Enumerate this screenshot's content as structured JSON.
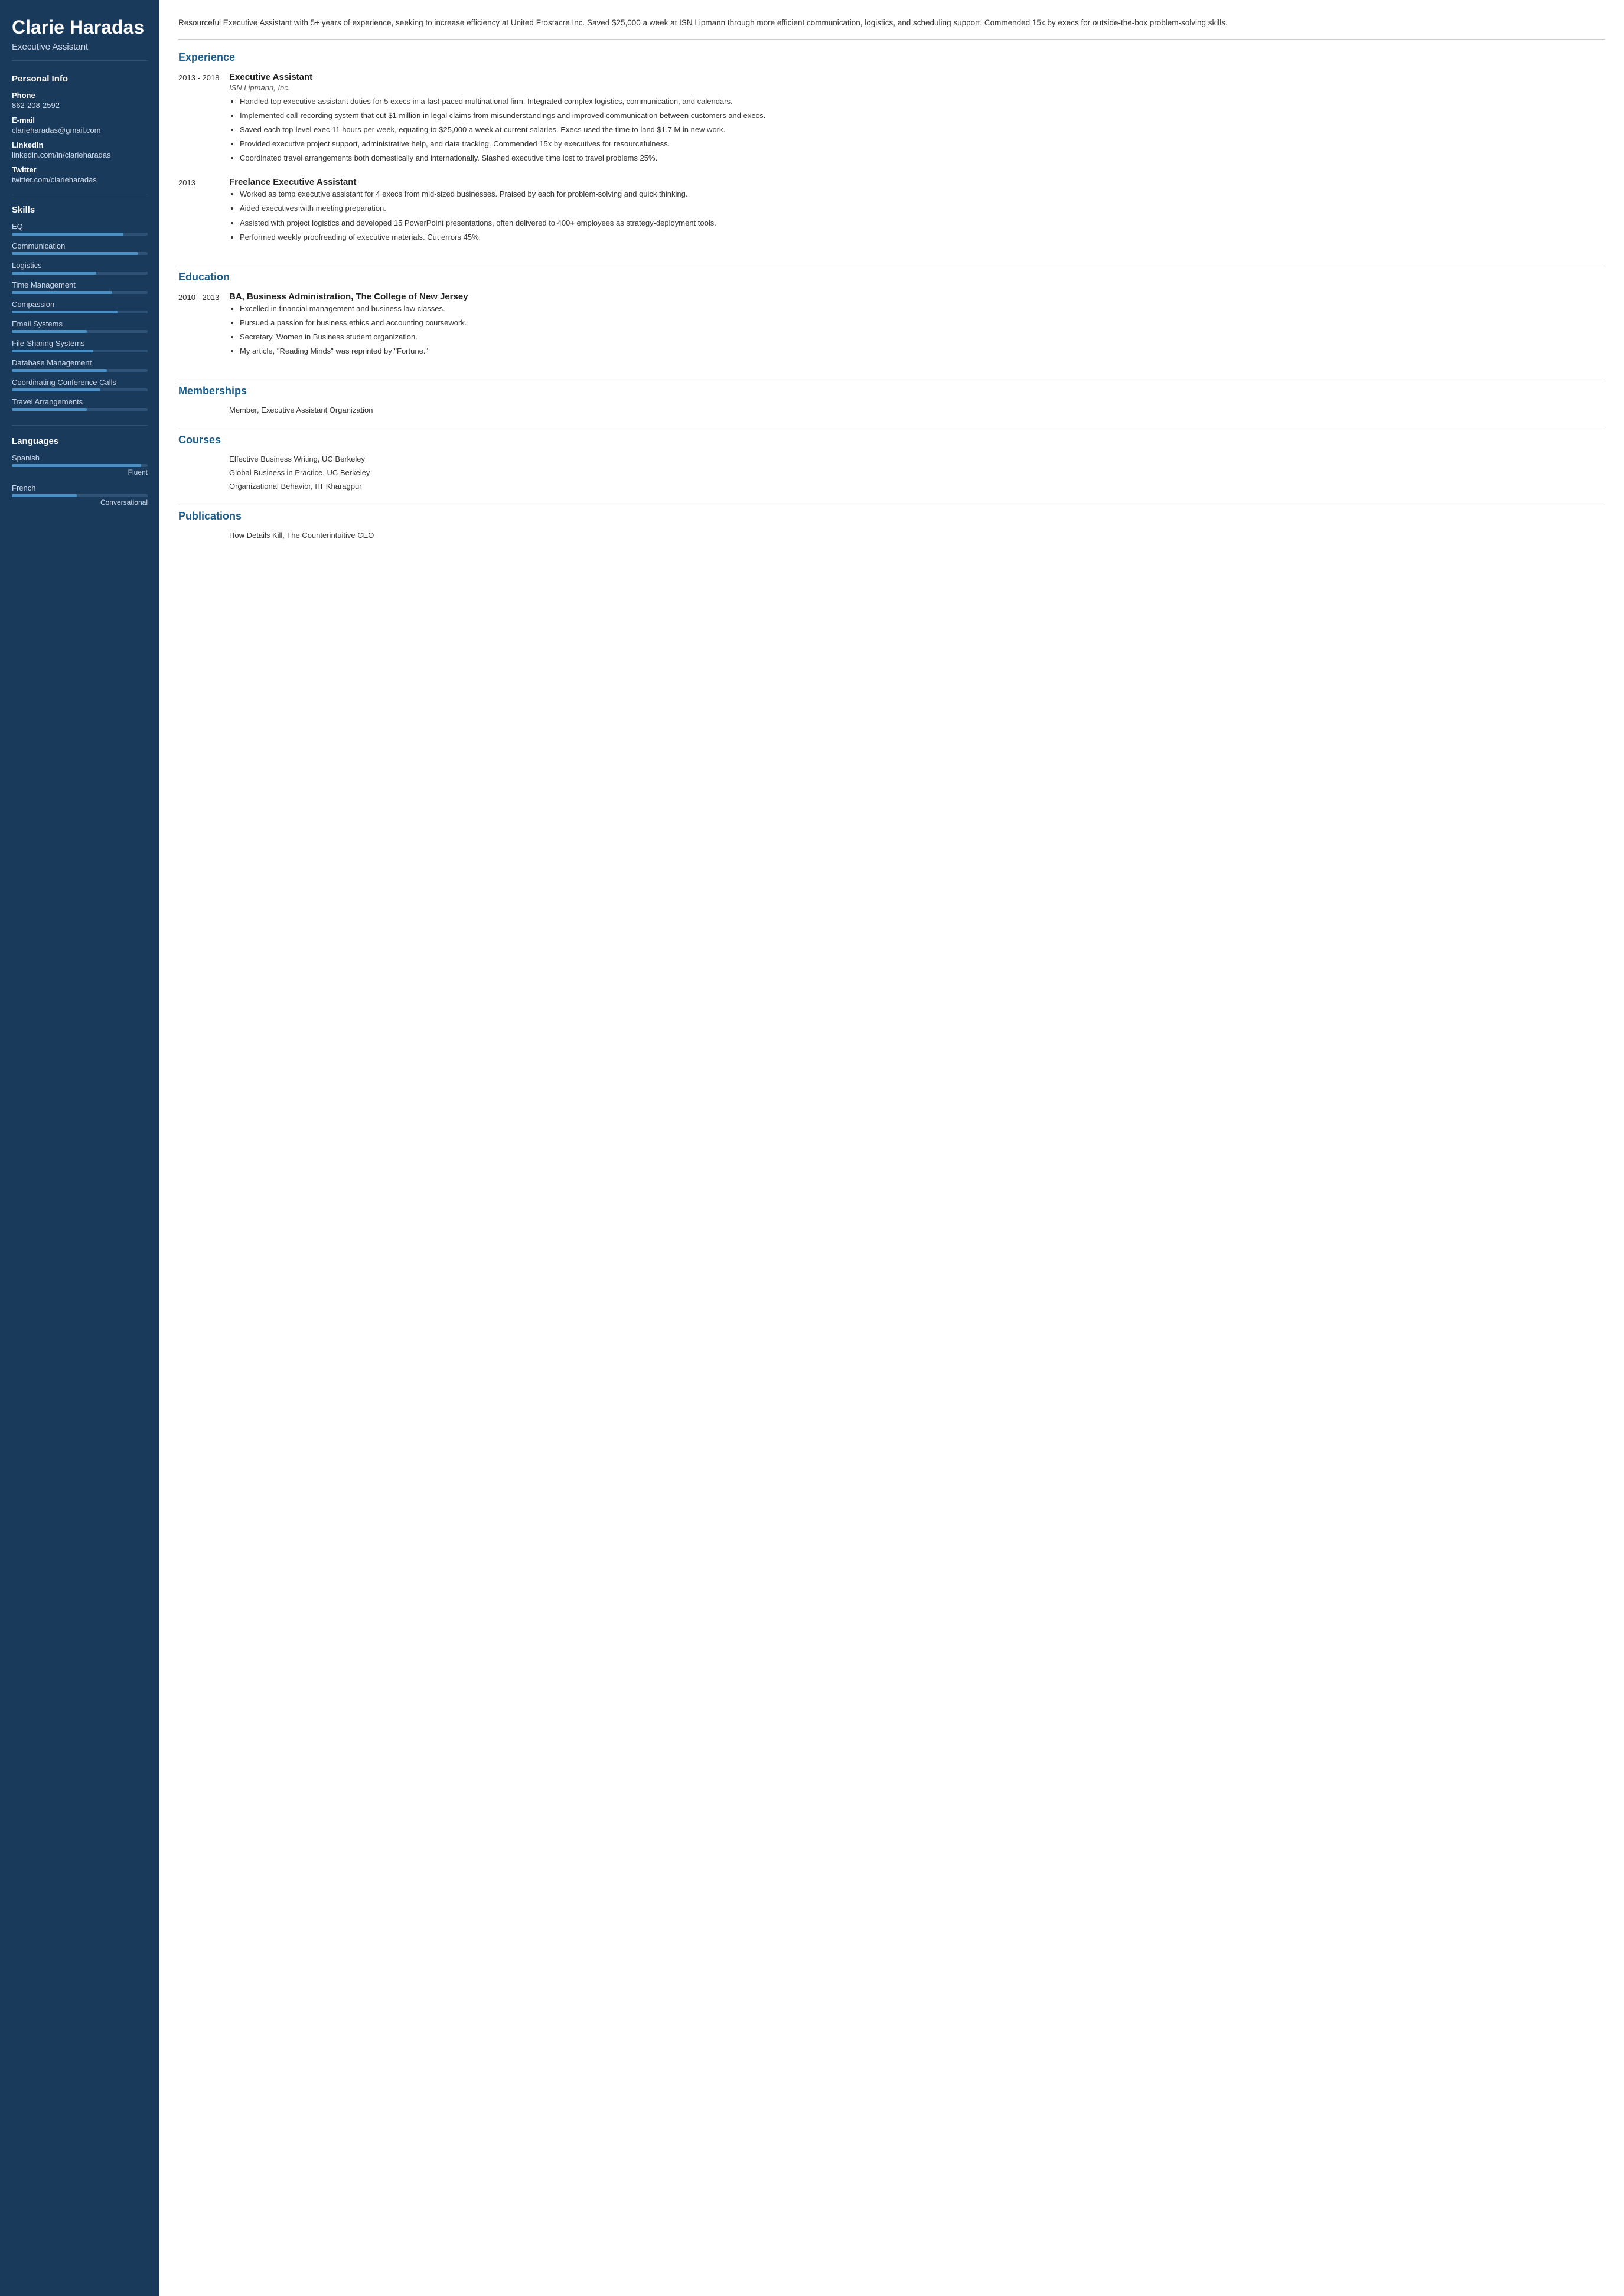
{
  "sidebar": {
    "name": "Clarie Haradas",
    "title": "Executive Assistant",
    "personal_info_title": "Personal Info",
    "phone_label": "Phone",
    "phone": "862-208-2592",
    "email_label": "E-mail",
    "email": "clarieharadas@gmail.com",
    "linkedin_label": "LinkedIn",
    "linkedin": "linkedin.com/in/clarieharadas",
    "twitter_label": "Twitter",
    "twitter": "twitter.com/clarieharadas",
    "skills_title": "Skills",
    "skills": [
      {
        "name": "EQ",
        "pct": 82
      },
      {
        "name": "Communication",
        "pct": 93
      },
      {
        "name": "Logistics",
        "pct": 62
      },
      {
        "name": "Time Management",
        "pct": 74
      },
      {
        "name": "Compassion",
        "pct": 78
      },
      {
        "name": "Email Systems",
        "pct": 55
      },
      {
        "name": "File-Sharing Systems",
        "pct": 60
      },
      {
        "name": "Database Management",
        "pct": 70
      },
      {
        "name": "Coordinating Conference Calls",
        "pct": 65
      },
      {
        "name": "Travel Arrangements",
        "pct": 55
      }
    ],
    "languages_title": "Languages",
    "languages": [
      {
        "name": "Spanish",
        "pct": 95,
        "level": "Fluent"
      },
      {
        "name": "French",
        "pct": 48,
        "level": "Conversational"
      }
    ]
  },
  "main": {
    "summary": "Resourceful Executive Assistant with 5+ years of experience, seeking to increase efficiency at United Frostacre Inc. Saved $25,000 a week at ISN Lipmann through more efficient communication, logistics, and scheduling support. Commended 15x by execs for outside-the-box problem-solving skills.",
    "experience_title": "Experience",
    "jobs": [
      {
        "date": "2013 - 2018",
        "title": "Executive Assistant",
        "company": "ISN Lipmann, Inc.",
        "bullets": [
          "Handled top executive assistant duties for 5 execs in a fast-paced multinational firm. Integrated complex logistics, communication, and calendars.",
          "Implemented call-recording system that cut $1 million in legal claims from misunderstandings and improved communication between customers and execs.",
          "Saved each top-level exec 11 hours per week, equating to $25,000 a week at current salaries. Execs used the time to land $1.7 M in new work.",
          "Provided executive project support, administrative help, and data tracking. Commended 15x by executives for resourcefulness.",
          "Coordinated travel arrangements both domestically and internationally. Slashed executive time lost to travel problems 25%."
        ]
      },
      {
        "date": "2013",
        "title": "Freelance Executive Assistant",
        "company": "",
        "bullets": [
          "Worked as temp executive assistant for 4 execs from mid-sized businesses. Praised by each for problem-solving and quick thinking.",
          "Aided executives with meeting preparation.",
          "Assisted with project logistics and developed 15 PowerPoint presentations, often delivered to 400+ employees as strategy-deployment tools.",
          "Performed weekly proofreading of executive materials. Cut errors 45%."
        ]
      }
    ],
    "education_title": "Education",
    "education": [
      {
        "date": "2010 - 2013",
        "title": "BA, Business Administration, The College of New Jersey",
        "bullets": [
          "Excelled in financial management and business law classes.",
          "Pursued a passion for business ethics and accounting coursework.",
          "Secretary, Women in Business student organization.",
          "My article, \"Reading Minds\" was reprinted by \"Fortune.\""
        ]
      }
    ],
    "memberships_title": "Memberships",
    "memberships": [
      {
        "text": "Member, Executive Assistant Organization"
      }
    ],
    "courses_title": "Courses",
    "courses": [
      {
        "text": "Effective Business Writing, UC Berkeley"
      },
      {
        "text": "Global Business in Practice, UC Berkeley"
      },
      {
        "text": "Organizational Behavior, IIT Kharagpur"
      }
    ],
    "publications_title": "Publications",
    "publications": [
      {
        "text": "How Details Kill, The Counterintuitive CEO"
      }
    ]
  }
}
